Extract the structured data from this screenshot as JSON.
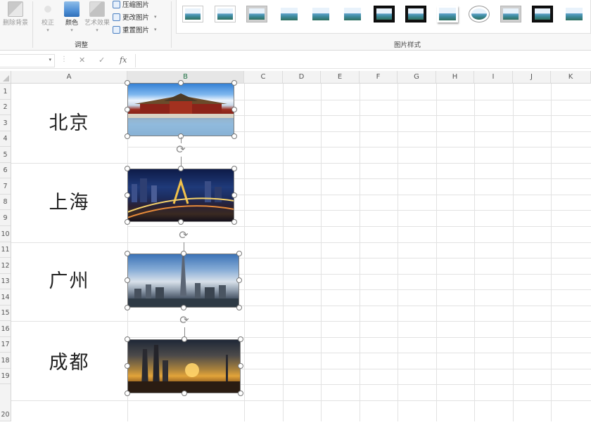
{
  "ribbon": {
    "adjust_buttons": [
      {
        "label": "删除背景",
        "icon": "remove-background-icon"
      },
      {
        "label": "校正",
        "icon": "correct-icon"
      },
      {
        "label": "颜色",
        "icon": "color-icon"
      },
      {
        "label": "艺术效果",
        "icon": "art-effect-icon"
      }
    ],
    "small_buttons": [
      {
        "label": "压缩图片",
        "icon": "compress-picture-icon"
      },
      {
        "label": "更改图片",
        "icon": "change-picture-icon"
      },
      {
        "label": "重置图片",
        "icon": "reset-picture-icon"
      }
    ],
    "group_adjust": "调整",
    "group_styles": "图片样式",
    "style_count": 12
  },
  "formula_bar": {
    "name_box_value": "",
    "cancel_icon": "✕",
    "enter_icon": "✓",
    "fx_label": "fx",
    "formula_value": ""
  },
  "sheet": {
    "columns": [
      "A",
      "B",
      "C",
      "D",
      "E",
      "F",
      "G",
      "H",
      "I",
      "J",
      "K"
    ],
    "selected_column": "B",
    "rows": [
      "1",
      "2",
      "3",
      "4",
      "5",
      "6",
      "7",
      "8",
      "9",
      "10",
      "11",
      "12",
      "13",
      "14",
      "15",
      "16",
      "17",
      "18",
      "19",
      "20"
    ],
    "cities": [
      "北京",
      "上海",
      "广州",
      "成都"
    ]
  },
  "pictures": [
    {
      "city": "北京",
      "scene": "forbidden-city"
    },
    {
      "city": "上海",
      "scene": "night-skyline"
    },
    {
      "city": "广州",
      "scene": "canton-tower"
    },
    {
      "city": "成都",
      "scene": "sunset-skyline"
    }
  ],
  "colors": {
    "accent": "#217346",
    "ribbon_bg": "#f7f7f7",
    "header_bg": "#f3f3f3",
    "gridline": "#e2e2e2"
  }
}
